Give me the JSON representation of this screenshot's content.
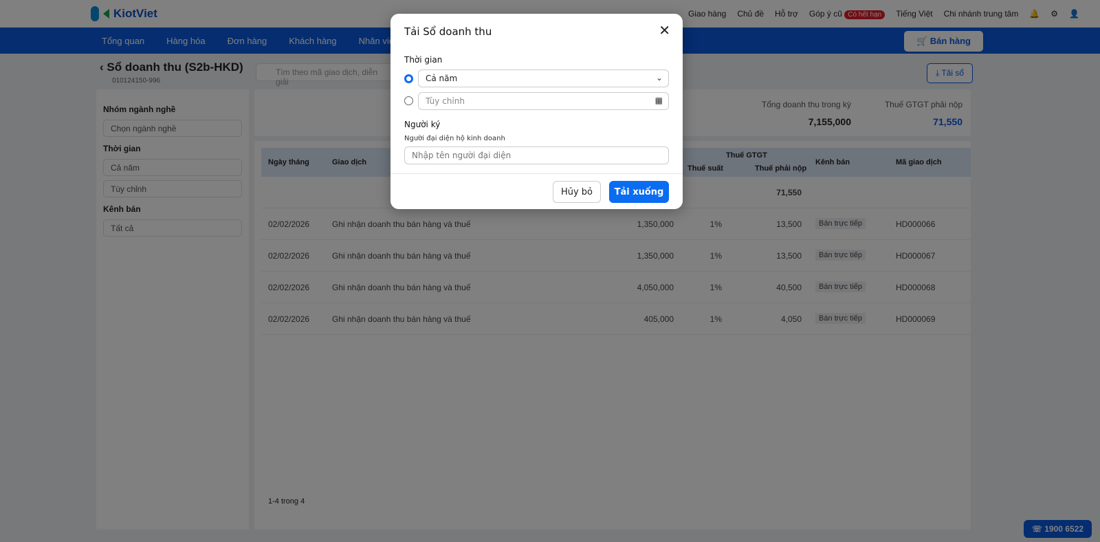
{
  "header": {
    "brand": "KiotViet",
    "links": [
      "Giao hàng",
      "Chủ đề",
      "Hỗ trợ",
      "Góp ý cũ"
    ],
    "badge": "Có hết hạn",
    "language": "Tiếng Việt",
    "branch": "Chi nhánh trung tâm",
    "notif_count": "0"
  },
  "nav": {
    "items": [
      "Tổng quan",
      "Hàng hóa",
      "Đơn hàng",
      "Khách hàng",
      "Nhân viên"
    ],
    "sell": "Bán hàng"
  },
  "page": {
    "title": "Sổ doanh thu (S2b-HKD)",
    "subtitle": "010124150-996",
    "search_placeholder": "Tìm theo mã giao dịch, diễn giải",
    "download": "Tải sổ"
  },
  "filters": {
    "group_label": "Nhóm ngành nghề",
    "group_value": "Chọn ngành nghề",
    "time_label": "Thời gian",
    "time_year": "Cả năm",
    "time_custom": "Tùy chỉnh",
    "channel_label": "Kênh bán",
    "channel_value": "Tất cả"
  },
  "summary": {
    "revenue_label": "Tổng doanh thu trong kỳ",
    "revenue": "7,155,000",
    "vat_label": "Thuế GTGT phải nộp",
    "vat": "71,550"
  },
  "table": {
    "headers": {
      "date": "Ngày tháng",
      "tx": "Giao dịch",
      "vat_group": "Thuế GTGT",
      "rate": "Thuế suất",
      "vat_due": "Thuế phải nộp",
      "channel": "Kênh bán",
      "code": "Mã giao dịch"
    },
    "total_vat": "71,550",
    "rows": [
      {
        "date": "02/02/2026",
        "tx": "Ghi nhận doanh thu bán hàng và thuế",
        "amount": "1,350,000",
        "rate": "1%",
        "vat": "13,500",
        "channel": "Bán trực tiếp",
        "code": "HD000066"
      },
      {
        "date": "02/02/2026",
        "tx": "Ghi nhận doanh thu bán hàng và thuế",
        "amount": "1,350,000",
        "rate": "1%",
        "vat": "13,500",
        "channel": "Bán trực tiếp",
        "code": "HD000067"
      },
      {
        "date": "02/02/2026",
        "tx": "Ghi nhận doanh thu bán hàng và thuế",
        "amount": "4,050,000",
        "rate": "1%",
        "vat": "40,500",
        "channel": "Bán trực tiếp",
        "code": "HD000068"
      },
      {
        "date": "02/02/2026",
        "tx": "Ghi nhận doanh thu bán hàng và thuế",
        "amount": "405,000",
        "rate": "1%",
        "vat": "4,050",
        "channel": "Bán trực tiếp",
        "code": "HD000069"
      }
    ],
    "pagination": "1-4 trong 4"
  },
  "hotline": "1900 6522",
  "modal": {
    "title": "Tải Sổ doanh thu",
    "time_label": "Thời gian",
    "option_year": "Cả năm",
    "option_custom": "Tùy chỉnh",
    "signer_label": "Người ký",
    "signer_sub": "Người đại diện hộ kinh doanh",
    "signer_placeholder": "Nhập tên người đại diện",
    "cancel": "Hủy bỏ",
    "download": "Tải xuống",
    "selected_option": "year"
  },
  "colors": {
    "primary": "#0a6cf0",
    "nav": "#0a5ae0"
  }
}
